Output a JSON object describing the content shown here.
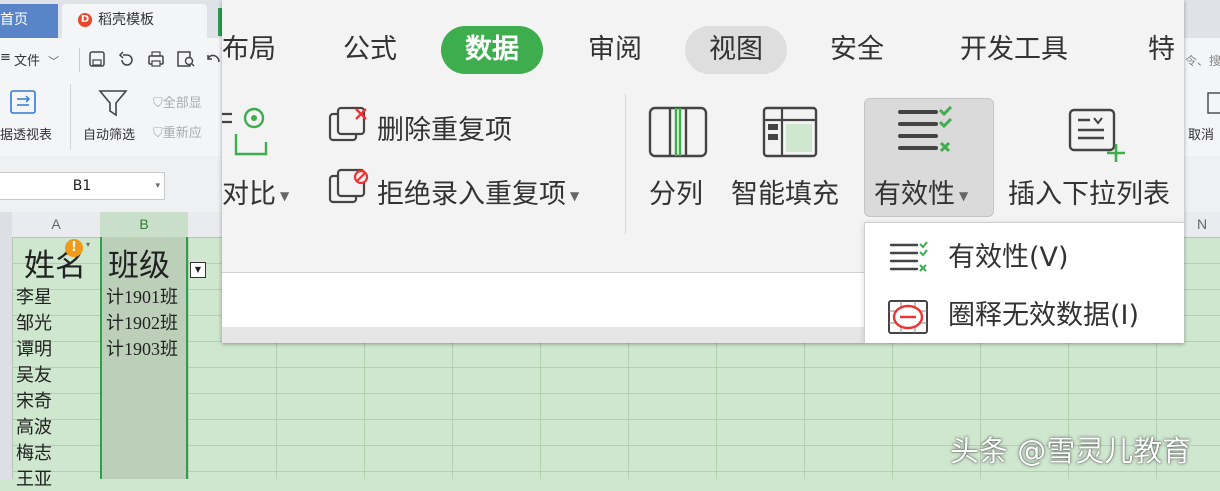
{
  "app": {
    "tabs": [
      {
        "label": "首页"
      },
      {
        "label": "稻壳模板"
      }
    ],
    "toolbar": {
      "file_menu": "文件",
      "right_cut": "令、搜"
    },
    "ribbon": {
      "pivot": "据透视表",
      "autofilter": "自动筛选",
      "show_all": "全部显",
      "reapply": "重新应",
      "cancel": "取消"
    },
    "name_box": "B1",
    "columns": [
      "A",
      "B",
      "N"
    ]
  },
  "sheet": {
    "header_a": "姓名",
    "header_b": "班级",
    "names": [
      "李星",
      "邹光",
      "谭明",
      "吴友",
      "宋奇",
      "高波",
      "梅志",
      "王亚"
    ],
    "classes": [
      "计1901班",
      "计1902班",
      "计1903班"
    ]
  },
  "zoom": {
    "tabs": [
      "布局",
      "公式",
      "数据",
      "审阅",
      "视图",
      "安全",
      "开发工具",
      "特"
    ],
    "active_tab": "数据",
    "buttons": {
      "compare": "对比",
      "remove_duplicates": "删除重复项",
      "reject_duplicates": "拒绝录入重复项",
      "split": "分列",
      "smart_fill": "智能填充",
      "validity": "有效性",
      "insert_dropdown": "插入下拉列表"
    },
    "menu": [
      {
        "label": "有效性(V)"
      },
      {
        "label": "圈释无效数据(I)"
      }
    ],
    "accent": "#3dad4e"
  },
  "watermark": "头条 @雪灵儿教育"
}
